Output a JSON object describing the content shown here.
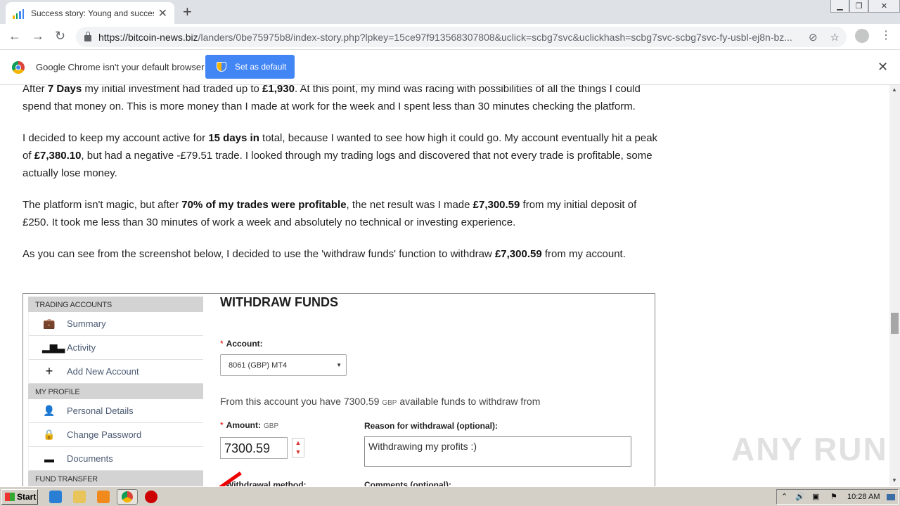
{
  "browser": {
    "tab_title": "Success story: Young and successful",
    "url_host": "https://bitcoin-news.biz",
    "url_path": "/landers/0be75975b8/index-story.php?lpkey=15ce97f913568307808&uclick=scbg7svc&uclickhash=scbg7svc-scbg7svc-fy-usbl-ej8n-bz...",
    "infobar_text": "Google Chrome isn't your default browser",
    "infobar_button": "Set as default"
  },
  "article": {
    "p1": [
      {
        "t": "After "
      },
      {
        "t": "7 Days",
        "b": true
      },
      {
        "t": " my initial investment had traded up to "
      },
      {
        "t": "£1,930",
        "b": true
      },
      {
        "t": ". At this point, my mind was racing with possibilities of all the things I could spend that money on. This is more money than I made at work for the week and I spent less than 30 minutes checking the platform."
      }
    ],
    "p2": [
      {
        "t": "I decided to keep my account active for "
      },
      {
        "t": "15 days in",
        "b": true
      },
      {
        "t": " total, because I wanted to see how high it could go. My account eventually hit a peak of "
      },
      {
        "t": "£7,380.10",
        "b": true
      },
      {
        "t": ", but had a negative -£79.51 trade. I looked through my trading logs and discovered that not every trade is profitable, some actually lose money."
      }
    ],
    "p3": [
      {
        "t": "The platform isn't magic, but after "
      },
      {
        "t": "70% of my trades were profitable",
        "b": true
      },
      {
        "t": ", the net result was I made "
      },
      {
        "t": "£7,300.59",
        "b": true
      },
      {
        "t": " from my initial deposit of £250. It took me less than 30 minutes of work a week and absolutely no technical or investing experience."
      }
    ],
    "p4": [
      {
        "t": "As you can see from the screenshot below, I decided to use the 'withdraw funds' function to withdraw "
      },
      {
        "t": "£7,300.59",
        "b": true
      },
      {
        "t": " from my account."
      }
    ]
  },
  "panel": {
    "sections": {
      "trading": "TRADING ACCOUNTS",
      "profile": "MY PROFILE",
      "fund": "FUND TRANSFER"
    },
    "items": {
      "summary": "Summary",
      "activity": "Activity",
      "add_account": "Add New Account",
      "personal": "Personal Details",
      "password": "Change Password",
      "documents": "Documents"
    },
    "form": {
      "title": "WITHDRAW FUNDS",
      "account_label": "Account:",
      "account_value": "8061     (GBP) MT4",
      "from_text_a": "From this account you have 7300.59",
      "from_unit": "GBP",
      "from_text_b": "available funds to withdraw from",
      "amount_label": "Amount:",
      "amount_unit": "GBP",
      "amount_value": "7300.59",
      "reason_label": "Reason for withdrawal (optional):",
      "reason_value": "Withdrawing my profits :)",
      "method_label": "Withdrawal method:",
      "comments_label": "Comments (optional):"
    }
  },
  "taskbar": {
    "start": "Start",
    "clock": "10:28 AM"
  },
  "watermark": "ANY RUN"
}
